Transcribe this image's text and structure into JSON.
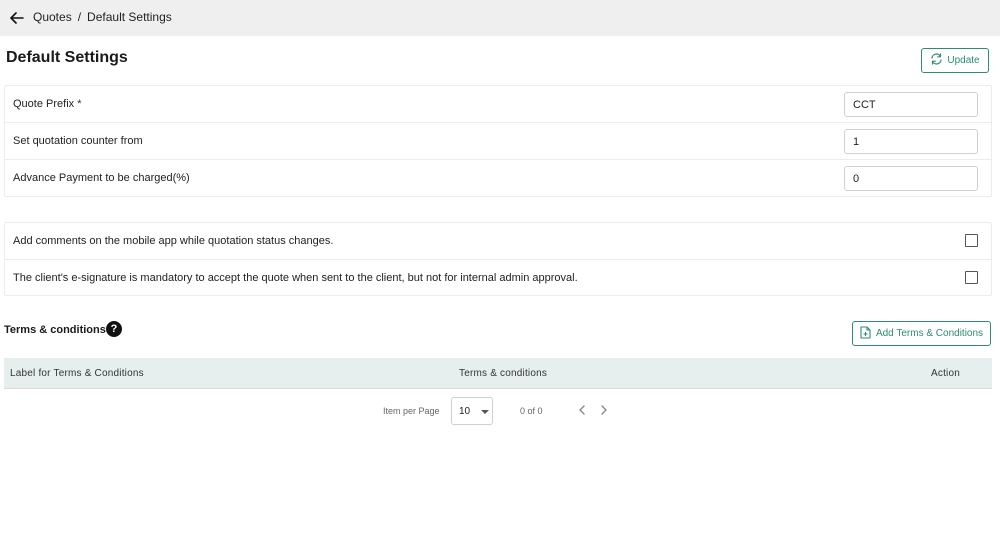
{
  "header": {
    "breadcrumb": [
      {
        "label": "Quotes"
      },
      {
        "label": "Default Settings"
      }
    ],
    "separator": "/"
  },
  "page": {
    "title": "Default Settings",
    "update_label": "Update"
  },
  "settings": [
    {
      "label": "Quote Prefix",
      "required_mark": "*",
      "value": "CCT"
    },
    {
      "label": "Set quotation counter from",
      "required_mark": "",
      "value": "1"
    },
    {
      "label": "Advance Payment to be charged(%)",
      "required_mark": "",
      "value": "0"
    }
  ],
  "toggles": [
    {
      "label": "Add comments on the mobile app while quotation status changes.",
      "checked": false
    },
    {
      "label": "The client's e-signature is mandatory to accept the quote when sent to the client, but not for internal admin approval.",
      "checked": false
    }
  ],
  "terms": {
    "heading": "Terms & conditions",
    "help_glyph": "?",
    "add_label": "Add Terms & Conditions",
    "columns": [
      "Label for Terms & Conditions",
      "Terms & conditions",
      "Action"
    ]
  },
  "pagination": {
    "items_per_page_label": "Item per Page",
    "items_per_page": "10",
    "range": "0 of 0"
  },
  "colors": {
    "accent": "#2e8b6e",
    "topbar": "#efefef",
    "table_header": "#e6efee"
  }
}
